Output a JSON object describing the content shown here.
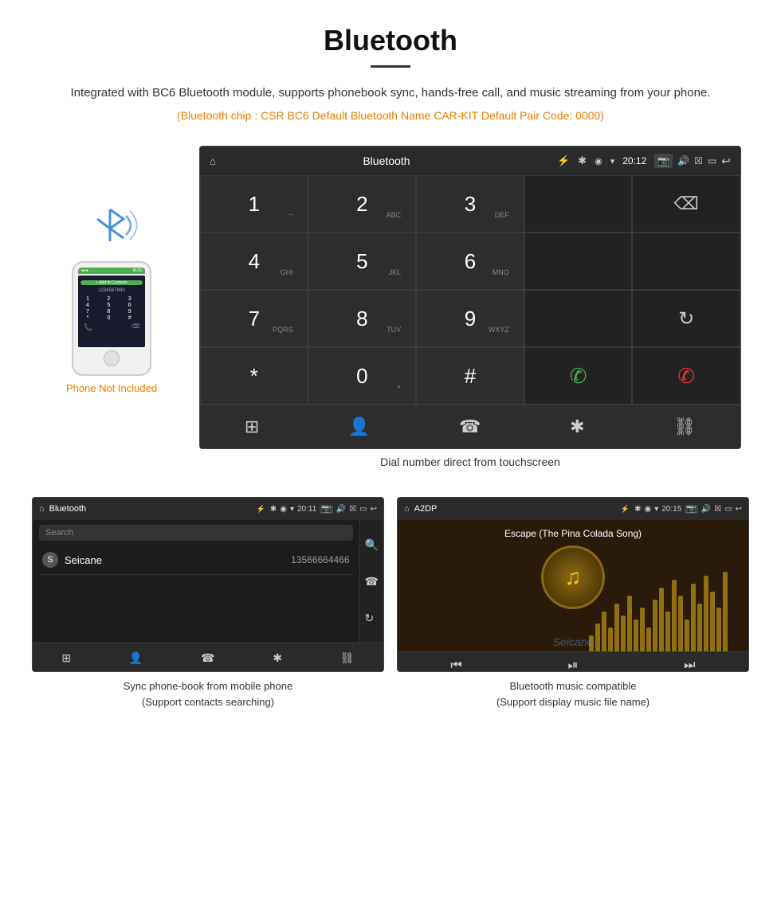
{
  "header": {
    "title": "Bluetooth",
    "description": "Integrated with BC6 Bluetooth module, supports phonebook sync, hands-free call, and music streaming from your phone.",
    "spec_line": "(Bluetooth chip : CSR BC6   Default Bluetooth Name CAR-KIT    Default Pair Code: 0000)"
  },
  "phone_illustration": {
    "label": "Phone Not Included"
  },
  "dial_screen": {
    "title": "Bluetooth",
    "time": "20:12",
    "keys": [
      {
        "num": "1",
        "sub": ""
      },
      {
        "num": "2",
        "sub": "ABC"
      },
      {
        "num": "3",
        "sub": "DEF"
      },
      {
        "num": "4",
        "sub": "GHI"
      },
      {
        "num": "5",
        "sub": "JKL"
      },
      {
        "num": "6",
        "sub": "MNO"
      },
      {
        "num": "7",
        "sub": "PQRS"
      },
      {
        "num": "8",
        "sub": "TUV"
      },
      {
        "num": "9",
        "sub": "WXYZ"
      },
      {
        "num": "*",
        "sub": ""
      },
      {
        "num": "0",
        "sub": "+"
      },
      {
        "num": "#",
        "sub": ""
      }
    ],
    "caption": "Dial number direct from touchscreen"
  },
  "phonebook_screen": {
    "title": "Bluetooth",
    "time": "20:11",
    "search_placeholder": "Search",
    "contacts": [
      {
        "initial": "S",
        "name": "Seicane",
        "number": "13566664466"
      }
    ],
    "caption_line1": "Sync phone-book from mobile phone",
    "caption_line2": "(Support contacts searching)"
  },
  "music_screen": {
    "title": "A2DP",
    "time": "20:15",
    "song_title": "Escape (The Pina Colada Song)",
    "caption_line1": "Bluetooth music compatible",
    "caption_line2": "(Support display music file name)"
  },
  "watermark": "Seicane",
  "icons": {
    "home": "⌂",
    "usb": "⚡",
    "bluetooth": "᛫",
    "location": "◉",
    "wifi": "▾",
    "camera": "📷",
    "volume": "🔊",
    "close_box": "☒",
    "screen": "▭",
    "back": "↩",
    "backspace": "⌫",
    "call_green": "📞",
    "call_red": "📞",
    "refresh": "↻",
    "grid": "⊞",
    "person": "👤",
    "phone_outline": "☎",
    "bt": "✱",
    "link": "🔗",
    "search": "🔍",
    "prev": "⏮",
    "play_pause": "⏯",
    "next": "⏭"
  }
}
